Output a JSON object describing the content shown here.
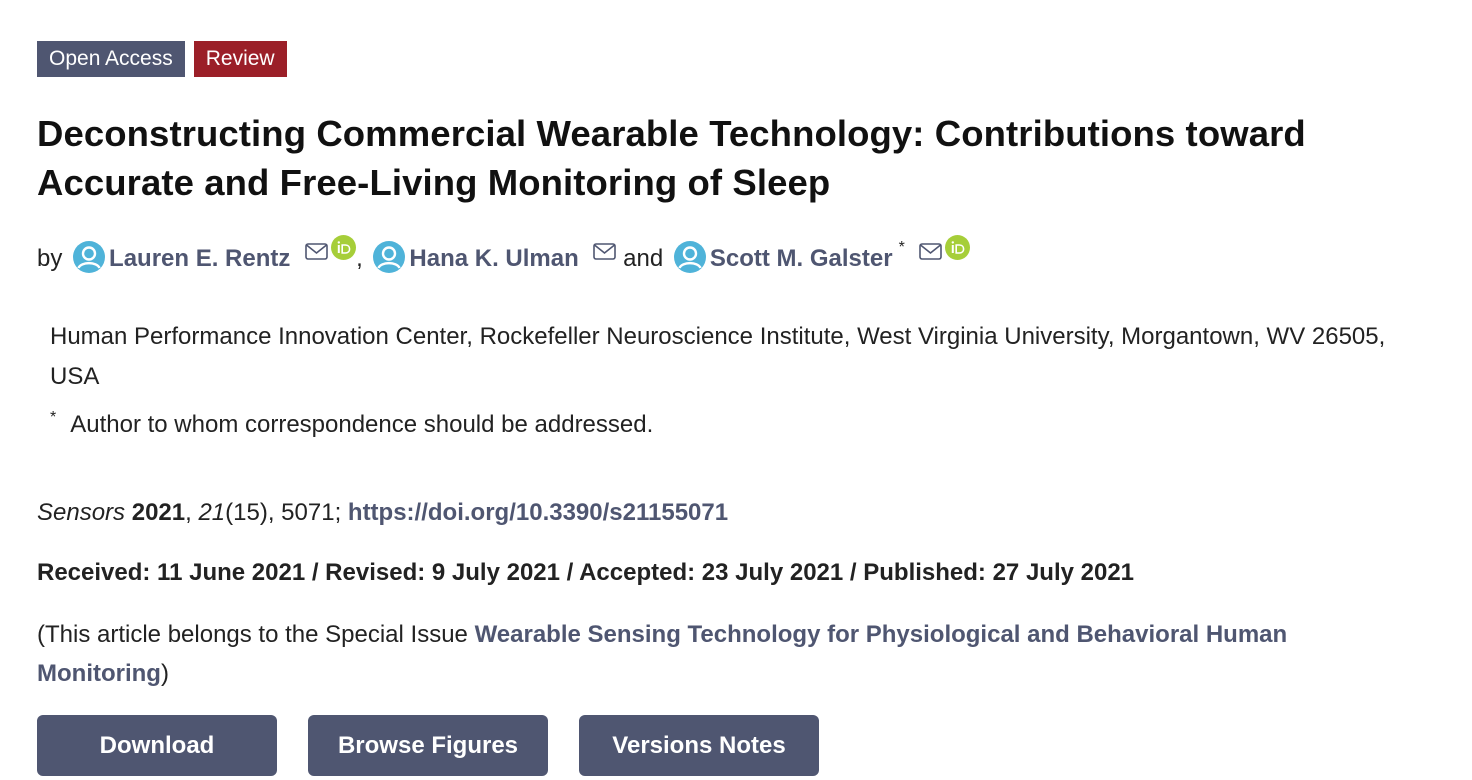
{
  "badges": {
    "open_access": "Open Access",
    "review": "Review"
  },
  "title": "Deconstructing Commercial Wearable Technology: Contributions toward Accurate and Free-Living Monitoring of Sleep",
  "authors": {
    "by": "by",
    "comma": ",",
    "and": "and",
    "star": "*",
    "list": [
      {
        "name": "Lauren E. Rentz",
        "has_orcid": true
      },
      {
        "name": "Hana K. Ulman",
        "has_orcid": false
      },
      {
        "name": "Scott M. Galster",
        "has_orcid": true,
        "corresponding": true
      }
    ]
  },
  "affiliation": "Human Performance Innovation Center, Rockefeller Neuroscience Institute, West Virginia University, Morgantown, WV 26505, USA",
  "correspondence": {
    "star": "*",
    "text": "Author to whom correspondence should be addressed."
  },
  "citation": {
    "journal": "Sensors",
    "year": "2021",
    "sep1": ", ",
    "volume": "21",
    "issue_pages": "(15), 5071; ",
    "doi": "https://doi.org/10.3390/s21155071"
  },
  "dates": "Received: 11 June 2021 / Revised: 9 July 2021 / Accepted: 23 July 2021 / Published: 27 July 2021",
  "special_issue": {
    "prefix": "(This article belongs to the Special Issue ",
    "link": "Wearable Sensing Technology for Physiological and Behavioral Human Monitoring",
    "suffix": ")"
  },
  "buttons": {
    "download": "Download",
    "browse_figures": "Browse Figures",
    "versions_notes": "Versions Notes"
  },
  "colors": {
    "accent": "#4f5671",
    "review": "#9b1f28",
    "user_icon": "#4fb3d9",
    "orcid": "#a6ce39"
  },
  "icons": {
    "user": "user-icon",
    "mail": "mail-icon",
    "orcid": "orcid-icon"
  }
}
